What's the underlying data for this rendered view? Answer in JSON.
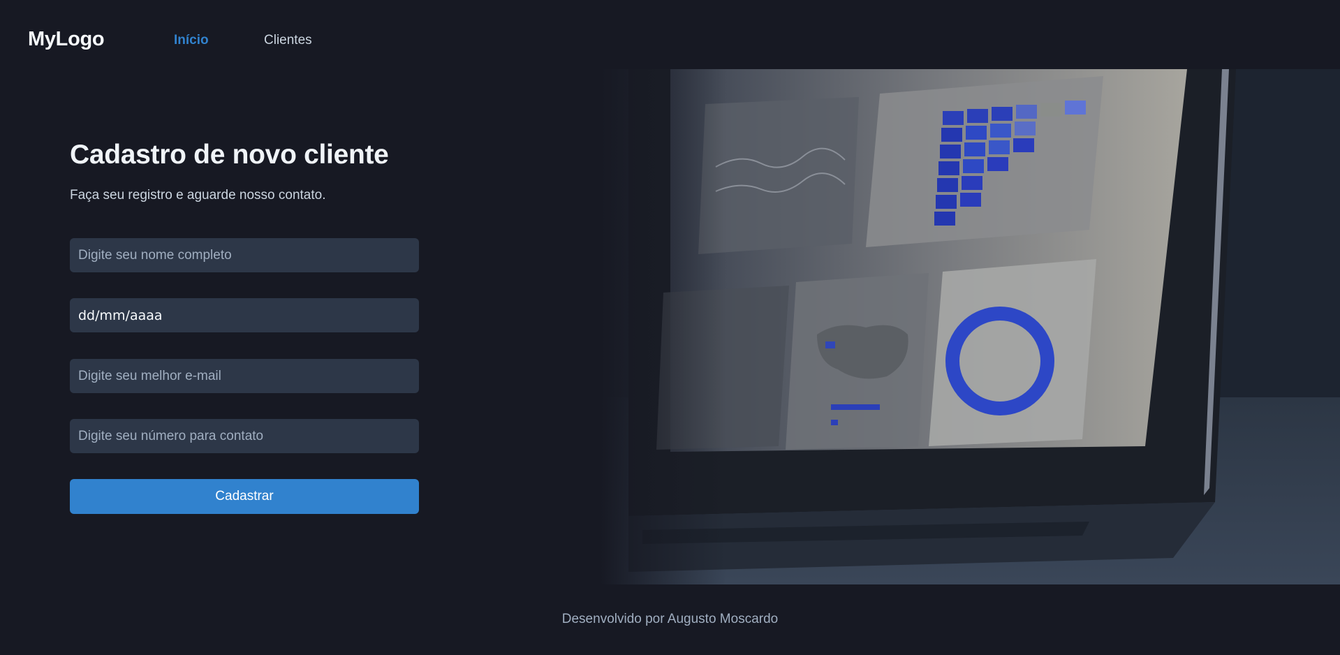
{
  "header": {
    "logo": "MyLogo",
    "nav": [
      {
        "label": "Início",
        "active": true
      },
      {
        "label": "Clientes",
        "active": false
      }
    ]
  },
  "form": {
    "title": "Cadastro de novo cliente",
    "subtitle": "Faça seu registro e aguarde nosso contato.",
    "name_placeholder": "Digite seu nome completo",
    "date_value": "dd/mm/aaaa",
    "email_placeholder": "Digite seu melhor e-mail",
    "phone_placeholder": "Digite seu número para contato",
    "submit_label": "Cadastrar"
  },
  "hero": {
    "description_icon": "laptop-analytics-photo"
  },
  "footer": {
    "credit": "Desenvolvido por Augusto Moscardo"
  },
  "colors": {
    "background": "#171923",
    "accent": "#3182ce",
    "input_bg": "#2d3748",
    "text_primary": "#f0f4f8",
    "text_muted": "#a0aec0"
  }
}
